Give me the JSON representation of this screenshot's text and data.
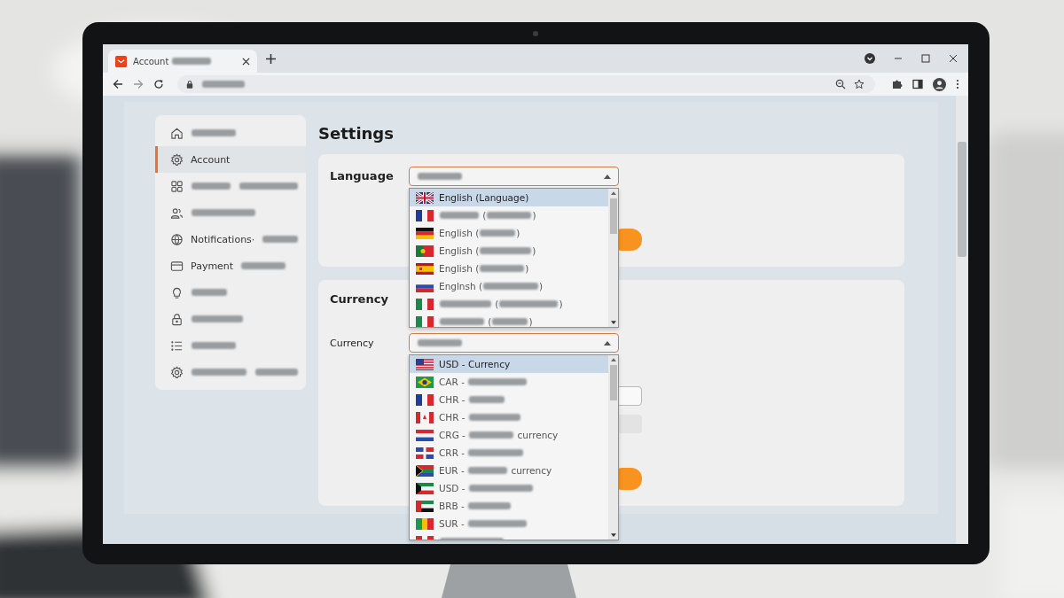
{
  "browser": {
    "tab": {
      "title": [
        {
          "kind": "text",
          "text": "Account"
        },
        {
          "kind": "blur"
        }
      ],
      "selected": true
    },
    "address_bar": {
      "value": [
        {
          "kind": "blur"
        }
      ]
    }
  },
  "sidebar": {
    "items": [
      {
        "label": [
          {
            "kind": "blur"
          }
        ],
        "selected": false
      },
      {
        "label": [
          {
            "kind": "text",
            "text": "Account"
          }
        ],
        "selected": true
      },
      {
        "label": [
          {
            "kind": "blur"
          },
          {
            "kind": "blur"
          }
        ],
        "selected": false
      },
      {
        "label": [
          {
            "kind": "blur"
          }
        ],
        "selected": false
      },
      {
        "label": [
          {
            "kind": "text",
            "text": "Notifications·"
          },
          {
            "kind": "blur"
          }
        ],
        "selected": false
      },
      {
        "label": [
          {
            "kind": "text",
            "text": "Payment"
          },
          {
            "kind": "blur"
          }
        ],
        "selected": false
      },
      {
        "label": [
          {
            "kind": "blur"
          }
        ],
        "selected": false
      },
      {
        "label": [
          {
            "kind": "blur"
          }
        ],
        "selected": false
      },
      {
        "label": [
          {
            "kind": "blur"
          }
        ],
        "selected": false
      },
      {
        "label": [
          {
            "kind": "blur"
          },
          {
            "kind": "blur"
          }
        ],
        "selected": false
      }
    ]
  },
  "title": "Settings",
  "language_section": {
    "heading": "Language",
    "select": {
      "value": [
        {
          "kind": "blur"
        }
      ],
      "expanded": true
    },
    "options": [
      {
        "label": [
          {
            "kind": "text",
            "text": "English (Language)"
          }
        ],
        "selected": true
      },
      {
        "label": [
          {
            "kind": "blur"
          },
          {
            "kind": "text",
            "text": " ("
          },
          {
            "kind": "blur"
          },
          {
            "kind": "text",
            "text": ")"
          }
        ],
        "selected": false
      },
      {
        "label": [
          {
            "kind": "text",
            "text": "English ("
          },
          {
            "kind": "blur"
          },
          {
            "kind": "text",
            "text": ")"
          }
        ],
        "selected": false
      },
      {
        "label": [
          {
            "kind": "text",
            "text": "English ("
          },
          {
            "kind": "blur"
          },
          {
            "kind": "text",
            "text": ")"
          }
        ],
        "selected": false
      },
      {
        "label": [
          {
            "kind": "text",
            "text": "English ("
          },
          {
            "kind": "blur"
          },
          {
            "kind": "text",
            "text": ")"
          }
        ],
        "selected": false
      },
      {
        "label": [
          {
            "kind": "text",
            "text": "Englnsh ("
          },
          {
            "kind": "blur"
          },
          {
            "kind": "text",
            "text": ")"
          }
        ],
        "selected": false
      },
      {
        "label": [
          {
            "kind": "blur"
          },
          {
            "kind": "text",
            "text": " ("
          },
          {
            "kind": "blur"
          },
          {
            "kind": "text",
            "text": ")"
          }
        ],
        "selected": false
      },
      {
        "label": [
          {
            "kind": "blur"
          },
          {
            "kind": "text",
            "text": " ("
          },
          {
            "kind": "blur"
          },
          {
            "kind": "text",
            "text": ")"
          }
        ],
        "selected": false
      }
    ]
  },
  "currency_section": {
    "heading": "Currency",
    "field_label": "Currency",
    "select": {
      "value": [
        {
          "kind": "blur"
        }
      ],
      "expanded": true
    },
    "options": [
      {
        "label": [
          {
            "kind": "text",
            "text": "USD - Currency"
          }
        ],
        "selected": true
      },
      {
        "label": [
          {
            "kind": "text",
            "text": "CAR - "
          },
          {
            "kind": "blur"
          }
        ],
        "selected": false
      },
      {
        "label": [
          {
            "kind": "text",
            "text": "CHR - "
          },
          {
            "kind": "blur"
          }
        ],
        "selected": false
      },
      {
        "label": [
          {
            "kind": "text",
            "text": "CHR - "
          },
          {
            "kind": "blur"
          }
        ],
        "selected": false
      },
      {
        "label": [
          {
            "kind": "text",
            "text": "CRG - "
          },
          {
            "kind": "blur"
          },
          {
            "kind": "text",
            "text": " currency"
          }
        ],
        "selected": false
      },
      {
        "label": [
          {
            "kind": "text",
            "text": "CRR - "
          },
          {
            "kind": "blur"
          }
        ],
        "selected": false
      },
      {
        "label": [
          {
            "kind": "text",
            "text": "EUR - "
          },
          {
            "kind": "blur"
          },
          {
            "kind": "text",
            "text": " currency"
          }
        ],
        "selected": false
      },
      {
        "label": [
          {
            "kind": "text",
            "text": "USD - "
          },
          {
            "kind": "blur"
          }
        ],
        "selected": false
      },
      {
        "label": [
          {
            "kind": "text",
            "text": "BRB - "
          },
          {
            "kind": "blur"
          }
        ],
        "selected": false
      },
      {
        "label": [
          {
            "kind": "text",
            "text": "SUR - "
          },
          {
            "kind": "blur"
          }
        ],
        "selected": false
      },
      {
        "label": [
          {
            "kind": "blur"
          }
        ],
        "selected": false
      }
    ]
  }
}
